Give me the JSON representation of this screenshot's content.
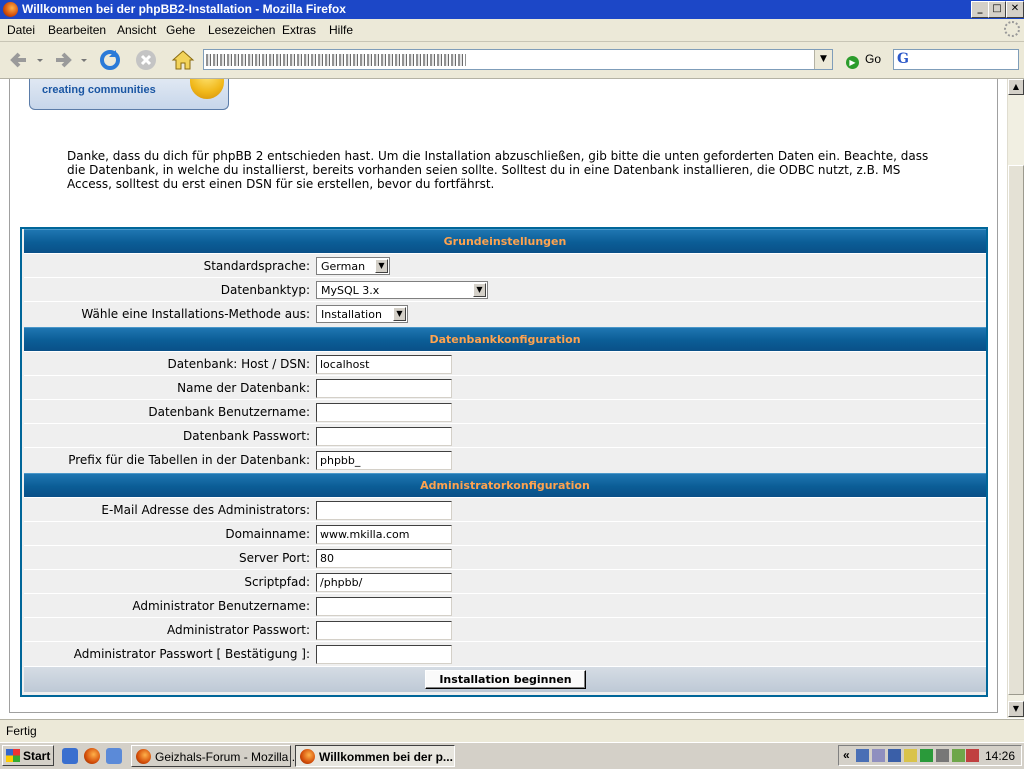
{
  "window": {
    "title": "Willkommen bei der phpBB2-Installation - Mozilla Firefox",
    "min": "_",
    "max": "□",
    "close": "✕"
  },
  "menu": [
    "Datei",
    "Bearbeiten",
    "Ansicht",
    "Gehe",
    "Lesezeichen",
    "Extras",
    "Hilfe"
  ],
  "toolbar": {
    "go_label": "Go",
    "search_engine": "G",
    "url_dropdown": "▼"
  },
  "logo": {
    "tagline": "creating communities"
  },
  "intro_text": "Danke, dass du dich für phpBB 2 entschieden hast. Um die Installation abzuschließen, gib bitte die unten geforderten Daten ein. Beachte, dass die Datenbank, in welche du installierst, bereits vorhanden seien sollte. Solltest du in eine Datenbank installieren, die ODBC nutzt, z.B. MS Access, solltest du erst einen DSN für sie erstellen, bevor du fortfährst.",
  "sections": {
    "basic": {
      "header": "Grundeinstellungen",
      "language_label": "Standardsprache:",
      "language_value": "German",
      "dbtype_label": "Datenbanktyp:",
      "dbtype_value": "MySQL 3.x",
      "method_label": "Wähle eine Installations-Methode aus:",
      "method_value": "Installation"
    },
    "database": {
      "header": "Datenbankkonfiguration",
      "host_label": "Datenbank: Host / DSN:",
      "host_value": "localhost",
      "name_label": "Name der Datenbank:",
      "name_value": "",
      "user_label": "Datenbank Benutzername:",
      "user_value": "",
      "pass_label": "Datenbank Passwort:",
      "pass_value": "",
      "prefix_label": "Prefix für die Tabellen in der Datenbank:",
      "prefix_value": "phpbb_"
    },
    "admin": {
      "header": "Administratorkonfiguration",
      "email_label": "E-Mail Adresse des Administrators:",
      "email_value": "",
      "domain_label": "Domainname:",
      "domain_value": "www.mkilla.com",
      "port_label": "Server Port:",
      "port_value": "80",
      "path_label": "Scriptpfad:",
      "path_value": "/phpbb/",
      "user_label": "Administrator Benutzername:",
      "user_value": "",
      "pass_label": "Administrator Passwort:",
      "pass_value": "",
      "pass2_label": "Administrator Passwort [ Bestätigung ]:",
      "pass2_value": ""
    },
    "submit_label": "Installation beginnen"
  },
  "scrollbar": {
    "up": "▲",
    "down": "▼"
  },
  "status": "Fertig",
  "taskbar": {
    "start": "Start",
    "items": [
      {
        "label": "Geizhals-Forum - Mozilla ..."
      },
      {
        "label": "Willkommen bei der p..."
      }
    ],
    "tray_chevron": "«",
    "clock": "14:26"
  },
  "colors": {
    "table_border": "#006699",
    "header_text": "#ffa34f",
    "row_bg": "#efefef"
  }
}
